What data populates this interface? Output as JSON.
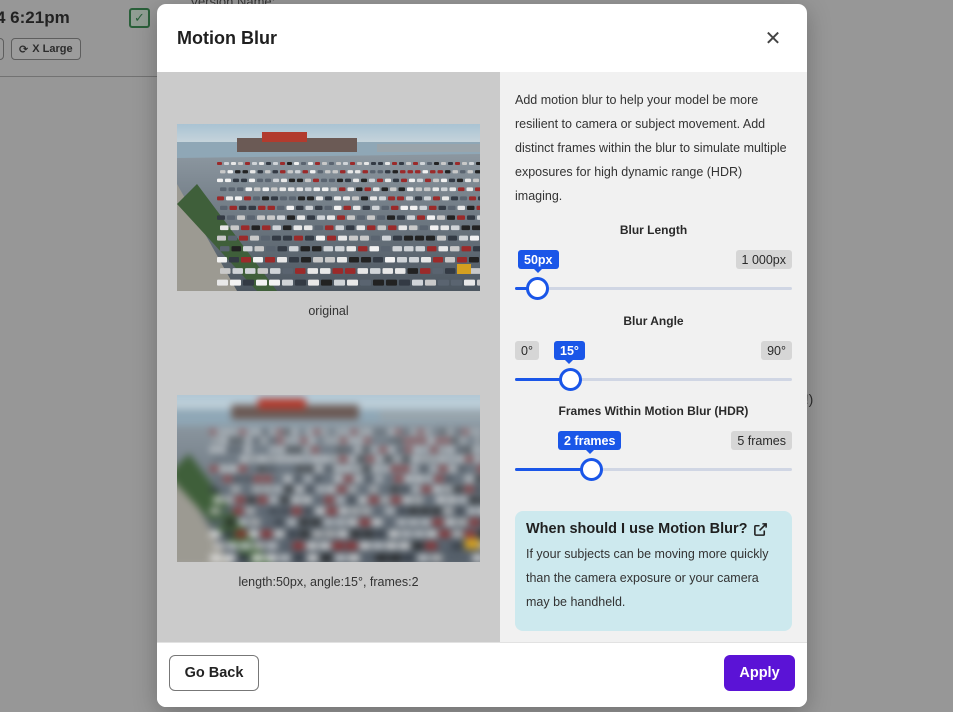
{
  "background": {
    "time": "4 6:21pm",
    "version_label": "Version Name:",
    "size_pill": "X Large",
    "partial_text": "d!)"
  },
  "modal": {
    "title": "Motion Blur",
    "close_icon": "close-icon",
    "preview": {
      "original_caption": "original",
      "augmented_caption": "length:50px, angle:15°, frames:2"
    },
    "description": "Add motion blur to help your model be more resilient to camera or subject movement. Add distinct frames within the blur to simulate multiple exposures for high dynamic range (HDR) imaging.",
    "sliders": [
      {
        "id": "blur-length",
        "title": "Blur Length",
        "min_label": "",
        "max_label": "1 000px",
        "value_label": "50px",
        "fraction": 0.08
      },
      {
        "id": "blur-angle",
        "title": "Blur Angle",
        "min_label": "0°",
        "max_label": "90°",
        "value_label": "15°",
        "fraction": 0.198
      },
      {
        "id": "frames",
        "title": "Frames Within Motion Blur (HDR)",
        "min_label": "",
        "max_label": "5 frames",
        "value_label": "2 frames",
        "fraction": 0.274
      }
    ],
    "info": {
      "title": "When should I use Motion Blur?",
      "icon": "external-link-icon",
      "text": "If your subjects can be moving more quickly than the camera exposure or your camera may be handheld."
    },
    "footer": {
      "back_label": "Go Back",
      "apply_label": "Apply"
    }
  },
  "colors": {
    "accent": "#1a56e8",
    "apply": "#5b13d6",
    "info_bg": "#cde9ee"
  }
}
